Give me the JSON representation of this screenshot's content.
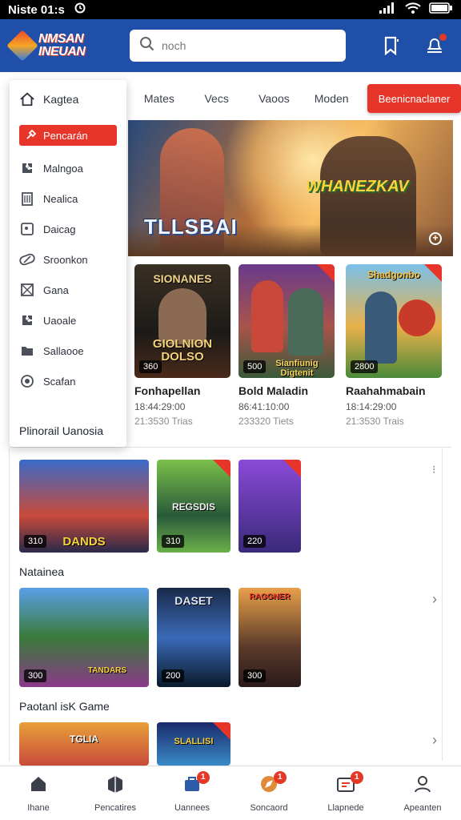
{
  "status_bar": {
    "time": "Niste 01:s",
    "icons": [
      "signal-icon",
      "wifi-icon",
      "battery-icon"
    ]
  },
  "header": {
    "logo_line1": "NMSAN",
    "logo_line2": "INEUAN",
    "search_placeholder": "noch"
  },
  "tabs": [
    "Mates",
    "Vecs",
    "Vaoos",
    "Moden"
  ],
  "tab_cta": "Beenicnaclaner",
  "side_menu": {
    "items": [
      {
        "label": "Kagtea",
        "icon": "home-icon"
      },
      {
        "label": "Pencarán",
        "icon": "search-icon"
      },
      {
        "label": "Malngoa",
        "icon": "puzzle-icon"
      },
      {
        "label": "Nealica",
        "icon": "building-icon"
      },
      {
        "label": "Daicag",
        "icon": "tag-icon"
      },
      {
        "label": "Sroonkon",
        "icon": "pill-icon"
      },
      {
        "label": "Gana",
        "icon": "grid-icon"
      },
      {
        "label": "Uaoale",
        "icon": "puzzle-icon"
      },
      {
        "label": "Sallaooe",
        "icon": "folder-icon"
      },
      {
        "label": "Scafan",
        "icon": "circle-icon"
      }
    ],
    "footer": "Plinorail Uanosia"
  },
  "hero": {
    "title_left": "TLLSBAI",
    "title_right": "WHANEZKAV"
  },
  "featured": [
    {
      "cover_text_top": "SIONANES",
      "cover_text_bottom": "GIOLNION DOLSO",
      "badge": "360",
      "name": "Fonhapellan",
      "meta": "18:44:29:00",
      "meta2": "21:3530 Trias"
    },
    {
      "cover_text_top": "",
      "cover_text_bottom": "Sianfiunig Digtenit",
      "badge": "500",
      "name": "Bold Maladin",
      "meta": "86:41:10:00",
      "meta2": "233320 Tiets"
    },
    {
      "cover_text_top": "Shadgonbo",
      "cover_text_bottom": "",
      "badge": "2800",
      "name": "Raahahmabain",
      "meta": "18:14:29:00",
      "meta2": "21:3530 Trais"
    }
  ],
  "row1": {
    "title": "",
    "items": [
      {
        "badge": "310",
        "text": "DANDS"
      },
      {
        "badge": "310",
        "text": "REGSDIS"
      },
      {
        "badge": "220",
        "text": ""
      }
    ]
  },
  "row2": {
    "title": "Natainea",
    "items": [
      {
        "badge": "300",
        "text": "TANDARS"
      },
      {
        "badge": "200",
        "text": "DASET"
      },
      {
        "badge": "300",
        "text": "RAGGNER"
      }
    ]
  },
  "row3": {
    "title": "Paotanl isK Game",
    "items": [
      {
        "badge": "",
        "text": "TGLIA"
      },
      {
        "badge": "",
        "text": "SLALLISI"
      }
    ]
  },
  "bottom_nav": [
    {
      "label": "Ihane",
      "icon": "home-icon",
      "badge": ""
    },
    {
      "label": "Pencatires",
      "icon": "puzzle-icon",
      "badge": ""
    },
    {
      "label": "Uannees",
      "icon": "trophy-icon",
      "badge": "1"
    },
    {
      "label": "Soncaord",
      "icon": "compass-icon",
      "badge": "1"
    },
    {
      "label": "Llapnede",
      "icon": "gift-icon",
      "badge": "1"
    },
    {
      "label": "Apeanten",
      "icon": "profile-icon",
      "badge": ""
    }
  ],
  "colors": {
    "header": "#1f4fa8",
    "accent": "#e8352a"
  }
}
